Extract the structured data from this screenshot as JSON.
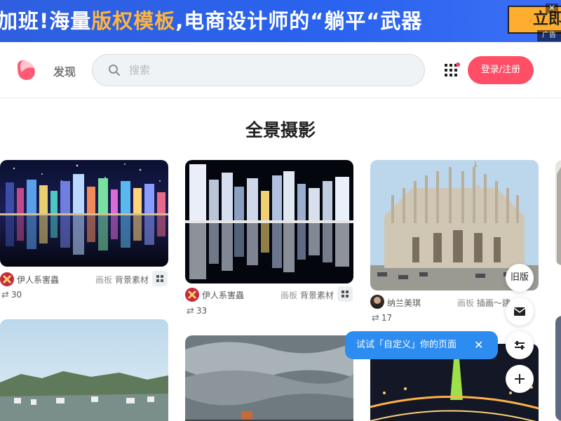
{
  "ad": {
    "text_prefix": "加班!海量",
    "text_highlight": "版权模板",
    "text_suffix": ",电商设计师的“躺平“武器",
    "button_label": "立即",
    "close_label": "✕",
    "tag_label": "广告"
  },
  "header": {
    "nav_discover": "发现",
    "search_placeholder": "搜索",
    "login_label": "登录/注册"
  },
  "page_title": "全景摄影",
  "pins": [
    {
      "user": "伊人系害蟲",
      "board_prefix": "画板",
      "board": "背景素材",
      "repins": "30"
    },
    {
      "user": "伊人系害蟲",
      "board_prefix": "画板",
      "board": "背景素材",
      "repins": "33"
    },
    {
      "user": "纳兰美琪",
      "board_prefix": "画板",
      "board": "插画～建",
      "repins": "17"
    }
  ],
  "floating": {
    "old_version": "旧版",
    "toast_text": "试试「自定义」你的页面",
    "toast_close": "✕"
  },
  "colors": {
    "ad_bg": "#2a63ef",
    "ad_highlight": "#ffb53d",
    "login_bg": "#ff4e66",
    "toast_bg": "#2d8cf0"
  }
}
